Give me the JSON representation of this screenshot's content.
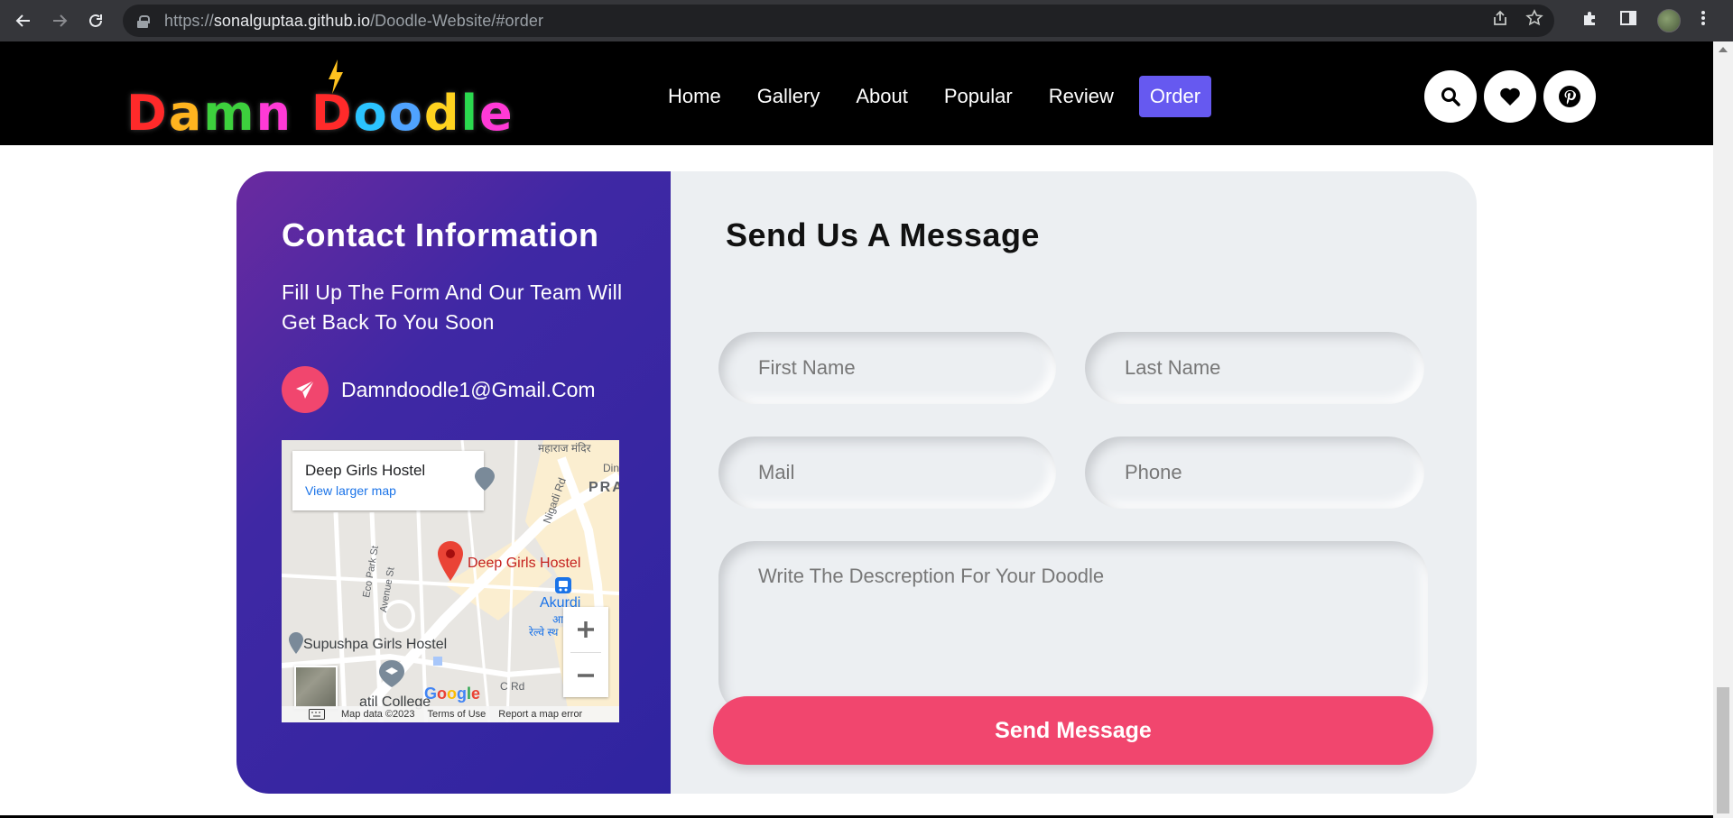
{
  "browser": {
    "url_scheme": "https://",
    "url_host": "sonalguptaa.github.io",
    "url_path": "/Doodle-Website/#order"
  },
  "site": {
    "logo_text": "Damn Doodle",
    "logo_letters": [
      {
        "char": "D",
        "color": "#ff2a2a"
      },
      {
        "char": "a",
        "color": "#ffb41f"
      },
      {
        "char": "m",
        "color": "#3dd13d"
      },
      {
        "char": "n",
        "color": "#ff3ad6"
      },
      {
        "char": " ",
        "color": "#ffffff"
      },
      {
        "char": "D",
        "color": "#ff2a2a"
      },
      {
        "char": "o",
        "color": "#2bc4ff"
      },
      {
        "char": "o",
        "color": "#4fa3ff"
      },
      {
        "char": "d",
        "color": "#ffd21f"
      },
      {
        "char": "l",
        "color": "#2bd94f"
      },
      {
        "char": "e",
        "color": "#ff3ad6"
      }
    ],
    "nav": [
      "Home",
      "Gallery",
      "About",
      "Popular",
      "Review"
    ],
    "nav_active": "Order",
    "header_icons": [
      "search-icon",
      "heart-icon",
      "pinterest-icon"
    ]
  },
  "contact": {
    "title": "Contact Information",
    "subtitle": "Fill Up The Form And Our Team Will Get Back To You Soon",
    "email": "Damndoodle1@Gmail.Com",
    "map": {
      "card_title": "Deep Girls Hostel",
      "card_link": "View larger map",
      "pin_label": "Deep Girls Hostel",
      "places": [
        "Supushpa Girls Hostel",
        "Akurdi",
        "atil College",
        "PRA"
      ],
      "roads": [
        "Nigadi Rd",
        "Eco Park St",
        "Avenue St",
        "C Rd",
        "महाराज मंदिर",
        "आकु",
        "रेल्वे स्थ",
        "Din"
      ],
      "footer": [
        "Map data ©2023",
        "Terms of Use",
        "Report a map error"
      ],
      "google": "Google"
    }
  },
  "form": {
    "title": "Send Us A Message",
    "first_name_placeholder": "First Name",
    "last_name_placeholder": "Last Name",
    "mail_placeholder": "Mail",
    "phone_placeholder": "Phone",
    "description_placeholder": "Write The Descreption For Your Doodle",
    "submit_label": "Send Message"
  },
  "colors": {
    "accent_pink": "#f1466e",
    "nav_active_bg": "#6659f0",
    "panel_gradient_start": "#6a2aa0",
    "panel_gradient_end": "#2f24a0"
  }
}
